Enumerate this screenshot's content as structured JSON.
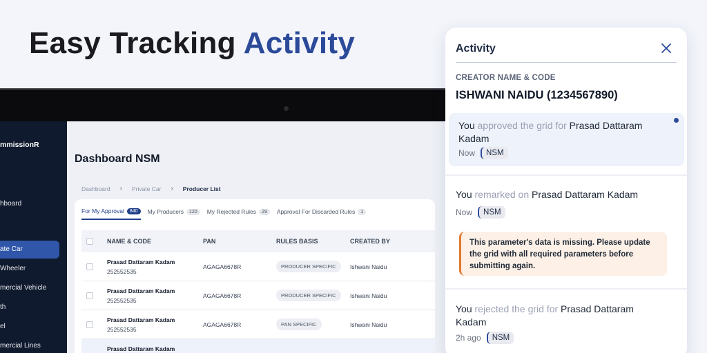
{
  "headline": {
    "part1": "Easy Tracking",
    "part2": "Activity"
  },
  "colors": {
    "accent": "#2c4a9a",
    "sidebar_bg": "#0f1a2e",
    "warning_border": "#e07a2e"
  },
  "sidebar": {
    "brand": "mmissionR",
    "items": [
      {
        "label": "hboard"
      },
      {
        "label": "ate Car",
        "active": true
      },
      {
        "label": "Wheeler"
      },
      {
        "label": "mercial Vehicle"
      },
      {
        "label": "th"
      },
      {
        "label": "el"
      },
      {
        "label": "mercial Lines"
      }
    ]
  },
  "dashboard": {
    "title": "Dashboard NSM",
    "breadcrumb": [
      "Dashboard",
      "Private Car",
      "Producer List"
    ],
    "tabs": [
      {
        "label": "For My Approval",
        "count": "840"
      },
      {
        "label": "My Producers",
        "count": "120"
      },
      {
        "label": "My Rejected Rules",
        "count": "29"
      },
      {
        "label": "Approval For Discarded Rules",
        "count": "1"
      }
    ],
    "columns": [
      "NAME & CODE",
      "PAN",
      "RULES BASIS",
      "CREATED BY"
    ],
    "rows": [
      {
        "name": "Prasad Dattaram Kadam",
        "code": "252552535",
        "pan": "AGAGA6678R",
        "basis": "PRODUCER SPECIFIC",
        "created_by": "Ishwani Naidu"
      },
      {
        "name": "Prasad Dattaram Kadam",
        "code": "252552535",
        "pan": "AGAGA6678R",
        "basis": "PRODUCER SPECIFIC",
        "created_by": "Ishwani Naidu"
      },
      {
        "name": "Prasad Dattaram Kadam",
        "code": "252552535",
        "pan": "AGAGA6678R",
        "basis": "PAN SPECIFIC",
        "created_by": "Ishwani Naidu"
      },
      {
        "name": "Prasad Dattaram Kadam"
      }
    ]
  },
  "activity": {
    "title": "Activity",
    "creator_label": "CREATOR NAME & CODE",
    "creator": "ISHWANI NAIDU (1234567890)",
    "items": [
      {
        "subject": "You",
        "action": "approved the grid for",
        "target": "Prasad Dattaram Kadam",
        "time": "Now",
        "badge": "NSM"
      },
      {
        "subject": "You",
        "action": "remarked on",
        "target": "Prasad Dattaram Kadam",
        "time": "Now",
        "badge": "NSM",
        "remark": "This parameter's data is missing. Please update the grid with all required parameters before submitting again."
      },
      {
        "subject": "You",
        "action": "rejected the grid for",
        "target": "Prasad Dattaram Kadam",
        "time": "2h ago",
        "badge": "NSM"
      }
    ]
  }
}
